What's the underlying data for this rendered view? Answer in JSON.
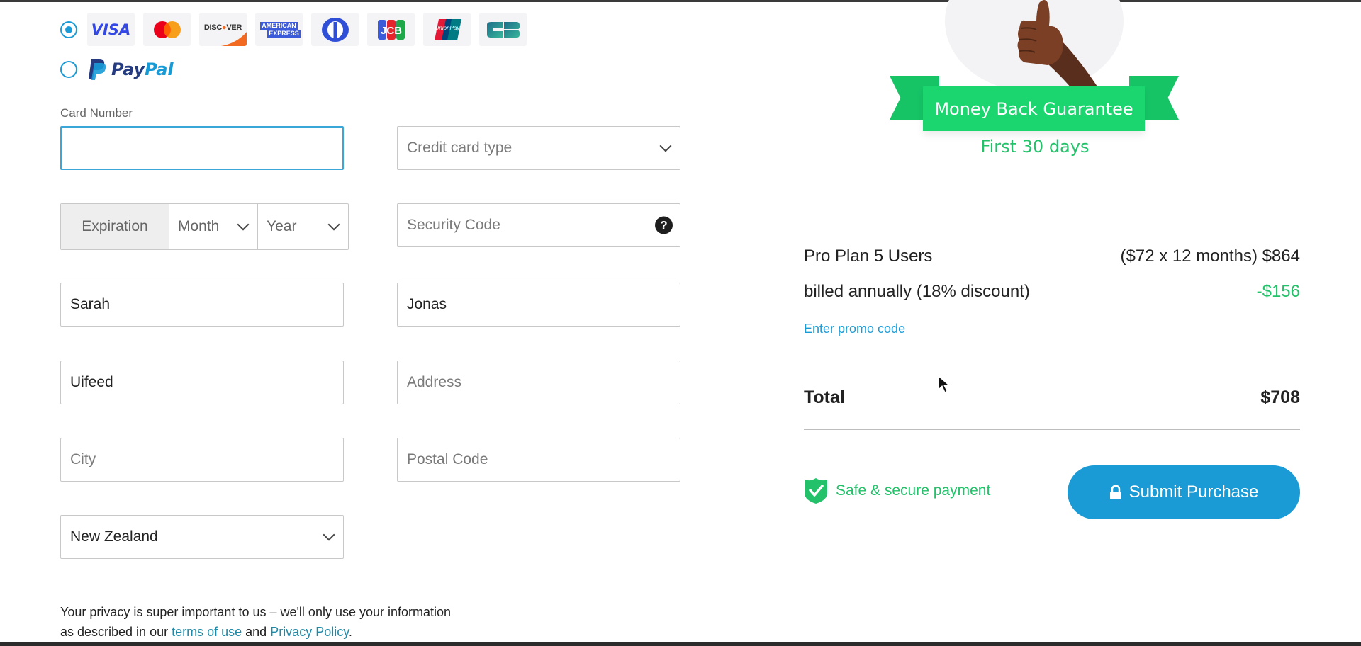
{
  "payment_methods": {
    "card_option_selected": true,
    "paypal_option_selected": false,
    "card_logos": [
      "VISA",
      "Mastercard",
      "DISCOVER",
      "AMERICAN EXPRESS",
      "Diners Club",
      "JCB",
      "UnionPay",
      "CB"
    ],
    "paypal": {
      "pay": "Pay",
      "pal": "Pal"
    }
  },
  "form": {
    "card_number_label": "Card Number",
    "card_number_value": "",
    "card_type_placeholder": "Credit card type",
    "expiration_label": "Expiration",
    "month_placeholder": "Month",
    "year_placeholder": "Year",
    "security_code_placeholder": "Security Code",
    "help_icon_glyph": "?",
    "first_name_value": "Sarah",
    "last_name_value": "Jonas",
    "company_value": "Uifeed",
    "address_placeholder": "Address",
    "city_placeholder": "City",
    "postal_code_placeholder": "Postal Code",
    "country_value": "New Zealand"
  },
  "privacy": {
    "line1": "Your privacy is super important to us – we'll only use your information",
    "line2_prefix": "as described in our ",
    "terms_link": "terms of use",
    "middle": " and ",
    "policy_link": "Privacy Policy",
    "suffix": "."
  },
  "guarantee": {
    "title": "Money Back Guarantee",
    "subtitle": "First 30 days"
  },
  "summary": {
    "plan_label": "Pro Plan 5 Users",
    "plan_price": "($72 x 12 months) $864",
    "discount_label": "billed annually (18% discount)",
    "discount_value": "-$156",
    "promo_link": "Enter promo code",
    "total_label": "Total",
    "total_value": "$708",
    "secure_text": "Safe & secure payment",
    "submit_label": "Submit Purchase"
  },
  "colors": {
    "accent_blue": "#1a9bd6",
    "success_green": "#22c16a",
    "ribbon_green": "#1bd66f"
  }
}
